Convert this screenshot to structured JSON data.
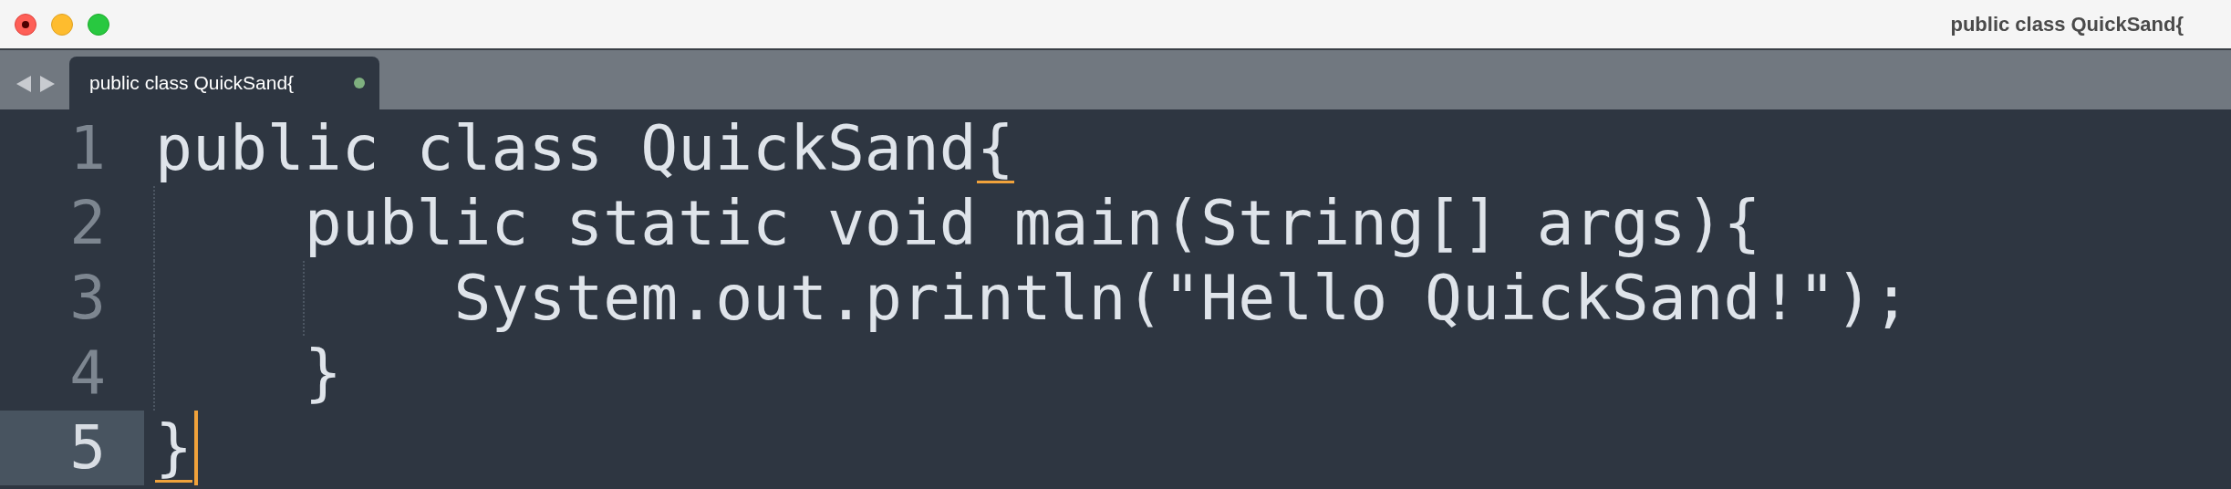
{
  "window": {
    "title": "public class QuickSand{"
  },
  "tabs": [
    {
      "label": "public class QuickSand{",
      "selected": true,
      "modified": true
    }
  ],
  "lines": [
    {
      "number": "1",
      "text": "public class QuickSand{",
      "current": false,
      "bracket_match": true,
      "children": [
        {
          "number": "2",
          "text": "public static void main(String[] args){",
          "current": false,
          "bracket_match": false,
          "children": [
            {
              "number": "3",
              "text": "System.out.println(\"Hello QuickSand!\");",
              "current": false,
              "bracket_match": false
            }
          ]
        },
        {
          "number": "4",
          "text": "}",
          "current": false,
          "bracket_match": false
        }
      ]
    },
    {
      "number": "5",
      "text": "}",
      "current": true,
      "bracket_match": true
    }
  ]
}
